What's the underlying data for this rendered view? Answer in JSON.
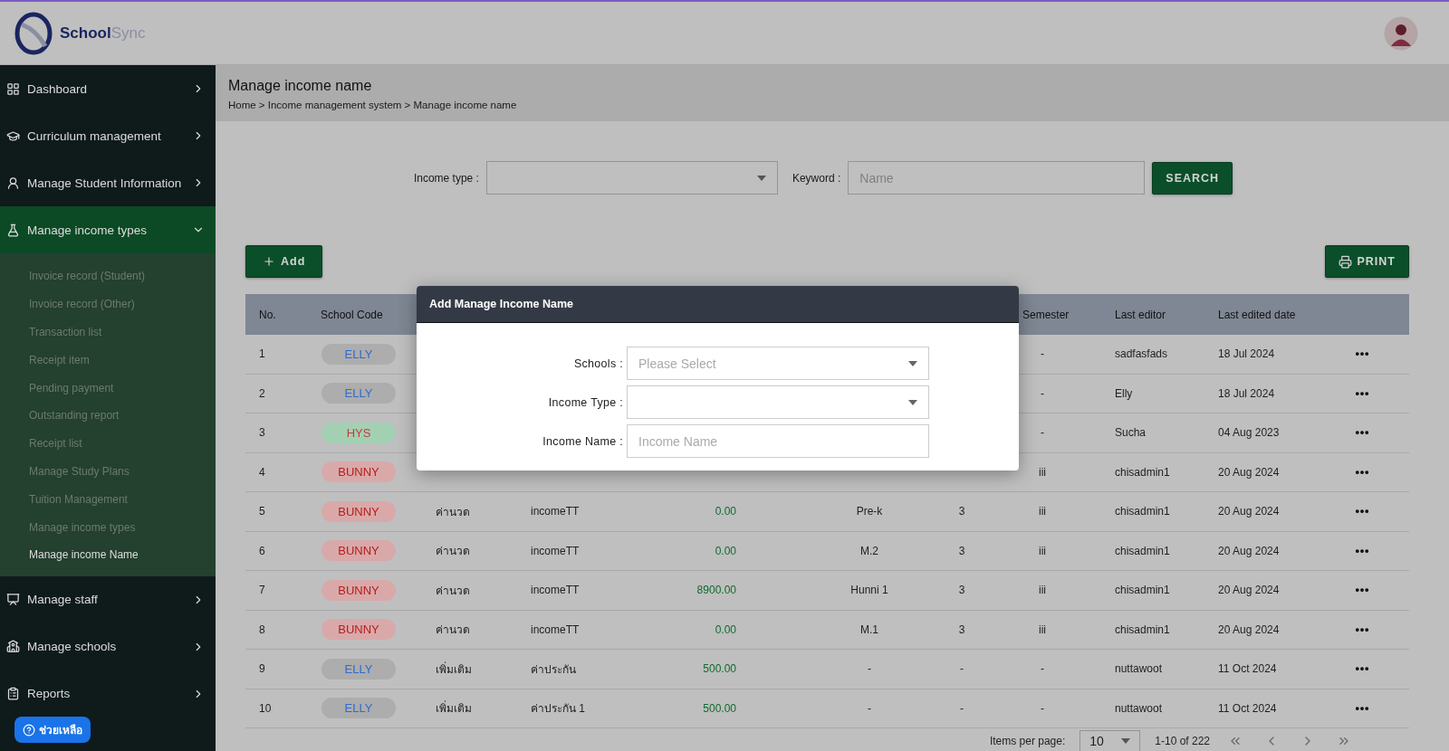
{
  "header": {
    "logo": {
      "primary": "School",
      "secondary": "Sync"
    }
  },
  "sidebar": {
    "items": [
      {
        "label": "Dashboard",
        "expanded": false
      },
      {
        "label": "Curriculum management",
        "expanded": false
      },
      {
        "label": "Manage Student Information",
        "expanded": false
      },
      {
        "label": "Manage income types",
        "expanded": true,
        "children": [
          {
            "label": "Invoice record (Student)",
            "selected": false
          },
          {
            "label": "Invoice record (Other)",
            "selected": false
          },
          {
            "label": "Transaction list",
            "selected": false
          },
          {
            "label": "Receipt item",
            "selected": false
          },
          {
            "label": "Pending payment",
            "selected": false
          },
          {
            "label": "Outstanding report",
            "selected": false
          },
          {
            "label": "Receipt list",
            "selected": false
          },
          {
            "label": "Manage Study Plans",
            "selected": false
          },
          {
            "label": "Tuition Management",
            "selected": false
          },
          {
            "label": "Manage income types",
            "selected": false
          },
          {
            "label": "Manage income Name",
            "selected": true
          }
        ]
      },
      {
        "label": "Manage staff",
        "expanded": false
      },
      {
        "label": "Manage schools",
        "expanded": false
      },
      {
        "label": "Reports",
        "expanded": false
      }
    ],
    "help_button": {
      "label": "ช่วยเหลือ"
    }
  },
  "page_header": {
    "title": "Manage income name",
    "breadcrumb": "Home > Income management system > Manage income name"
  },
  "filters": {
    "income_type": {
      "label": "Income type :"
    },
    "keyword": {
      "label": "Keyword :",
      "placeholder": "Name"
    },
    "search_button": "SEARCH"
  },
  "actions": {
    "add_button": "Add",
    "print_button": "PRINT"
  },
  "table": {
    "columns": [
      {
        "label": "No."
      },
      {
        "label": "School Code"
      },
      {},
      {},
      {},
      {},
      {},
      {
        "label": "Semester"
      },
      {
        "label": "Last editor"
      },
      {
        "label": "Last edited date"
      },
      {}
    ],
    "rows": [
      {
        "no": "1",
        "school_code": {
          "text": "ELLY",
          "kind": "neutral",
          "color": "#2f6bd0"
        },
        "semester": "-",
        "last_editor": "sadfasfads",
        "last_edited_date": "18 Jul 2024"
      },
      {
        "no": "2",
        "school_code": {
          "text": "ELLY",
          "kind": "neutral",
          "color": "#2f6bd0"
        },
        "semester": "-",
        "last_editor": "Elly",
        "last_edited_date": "18 Jul 2024"
      },
      {
        "no": "3",
        "school_code": {
          "text": "HYS",
          "kind": "success",
          "color": "#c83a3a"
        },
        "semester": "-",
        "last_editor": "Sucha",
        "last_edited_date": "04 Aug 2023"
      },
      {
        "no": "4",
        "school_code": {
          "text": "BUNNY",
          "kind": "danger",
          "color": "#b71c1c"
        },
        "semester": "iii",
        "last_editor": "chisadmin1",
        "last_edited_date": "20 Aug 2024"
      },
      {
        "no": "5",
        "school_code": {
          "text": "BUNNY",
          "kind": "danger",
          "color": "#b71c1c"
        },
        "column_3": "ค่านวด",
        "column_4": "incomeTT",
        "column_5": "0.00",
        "column_6": "Pre-k",
        "column_7": "3",
        "semester": "iii",
        "last_editor": "chisadmin1",
        "last_edited_date": "20 Aug 2024"
      },
      {
        "no": "6",
        "school_code": {
          "text": "BUNNY",
          "kind": "danger",
          "color": "#b71c1c"
        },
        "column_3": "ค่านวด",
        "column_4": "incomeTT",
        "column_5": "0.00",
        "column_6": "M.2",
        "column_7": "3",
        "semester": "iii",
        "last_editor": "chisadmin1",
        "last_edited_date": "20 Aug 2024"
      },
      {
        "no": "7",
        "school_code": {
          "text": "BUNNY",
          "kind": "danger",
          "color": "#b71c1c"
        },
        "column_3": "ค่านวด",
        "column_4": "incomeTT",
        "column_5": "8900.00",
        "column_6": "Hunni 1",
        "column_7": "3",
        "semester": "iii",
        "last_editor": "chisadmin1",
        "last_edited_date": "20 Aug 2024"
      },
      {
        "no": "8",
        "school_code": {
          "text": "BUNNY",
          "kind": "danger",
          "color": "#b71c1c"
        },
        "column_3": "ค่านวด",
        "column_4": "incomeTT",
        "column_5": "0.00",
        "column_6": "M.1",
        "column_7": "3",
        "semester": "iii",
        "last_editor": "chisadmin1",
        "last_edited_date": "20 Aug 2024"
      },
      {
        "no": "9",
        "school_code": {
          "text": "ELLY",
          "kind": "neutral",
          "color": "#2f6bd0"
        },
        "column_3": "เพิ่มเติม",
        "column_4": "ค่าประกัน",
        "column_5": "500.00",
        "column_6": "-",
        "column_7": "-",
        "semester": "-",
        "last_editor": "nuttawoot",
        "last_edited_date": "11 Oct 2024"
      },
      {
        "no": "10",
        "school_code": {
          "text": "ELLY",
          "kind": "neutral",
          "color": "#2f6bd0"
        },
        "column_3": "เพิ่มเติม",
        "column_4": "ค่าประกัน 1",
        "column_5": "500.00",
        "column_6": "-",
        "column_7": "-",
        "semester": "-",
        "last_editor": "nuttawoot",
        "last_edited_date": "11 Oct 2024"
      }
    ]
  },
  "pagination": {
    "items_per_page_label": "Items per page:",
    "items_per_page": "10",
    "range": "1-10 of 222"
  },
  "modal": {
    "title": "Add Manage Income Name",
    "fields": [
      {
        "label": "Schools :",
        "kind": "select",
        "placeholder": "Please Select"
      },
      {
        "label": "Income Type :",
        "kind": "select"
      },
      {
        "label": "Income Name :",
        "kind": "text",
        "placeholder": "Income Name"
      }
    ]
  }
}
